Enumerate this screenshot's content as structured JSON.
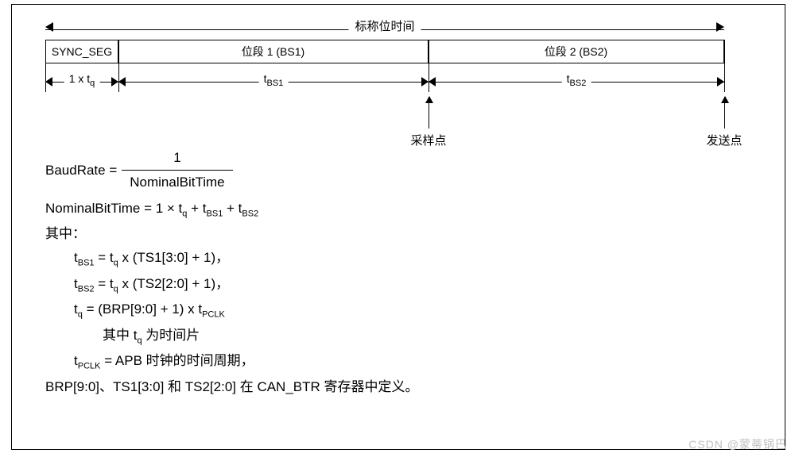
{
  "diagram": {
    "nominal_label": "标称位时间",
    "segments": {
      "sync": "SYNC_SEG",
      "bs1": "位段 1 (BS1)",
      "bs2": "位段 2 (BS2)"
    },
    "sub_labels": {
      "tq_html": "1 x t<sub>q</sub>",
      "tbs1_html": "t<sub>BS1</sub>",
      "tbs2_html": "t<sub>BS2</sub>"
    },
    "points": {
      "sample": "采样点",
      "send": "发送点"
    }
  },
  "formulas": {
    "baud_lhs": "BaudRate  =",
    "baud_num": "1",
    "baud_den": "NominalBitTime",
    "nominal_html": "NominalBitTime  =  1 × t<sub>q</sub> + t<sub>BS1</sub> + t<sub>BS2</sub>",
    "where": "其中：",
    "tbs1_html": "t<sub>BS1</sub> = t<sub>q</sub> x (TS1[3:0] + 1)，",
    "tbs2_html": "t<sub>BS2</sub> = t<sub>q</sub> x (TS2[2:0] + 1)，",
    "tq_html": "t<sub>q</sub> = (BRP[9:0] + 1) x t<sub>PCLK</sub>",
    "tq_note_html": "其中 t<sub>q</sub> 为时间片",
    "tpclk_html": "t<sub>PCLK</sub> = APB 时钟的时间周期，",
    "footer": "BRP[9:0]、TS1[3:0] 和 TS2[2:0] 在 CAN_BTR 寄存器中定义。"
  },
  "watermark": "CSDN @蒙蒂锅巴"
}
